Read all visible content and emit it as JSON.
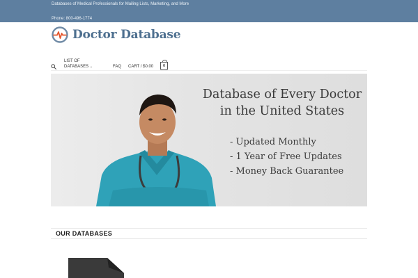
{
  "topbar": {
    "tagline": "Databases of Medical Professionals for Mailing Lists, Marketing, and More",
    "phone": "Phone: 800-496-1774",
    "color": "#5e7fa0"
  },
  "logo": {
    "text": "Doctor Database",
    "color": "#4d6f8f",
    "accent": "#e4572e"
  },
  "nav": {
    "search_icon": "search-icon",
    "list_line1": "List of",
    "list_line2": "Databases",
    "list_chevron": "⌄",
    "faq": "FAQ",
    "cart": "Cart / $0.00",
    "cart_count": "0"
  },
  "hero": {
    "title_line1": "Database of Every Doctor",
    "title_line2": "in the United States",
    "bullets": [
      "- Updated Monthly",
      "- 1 Year of Free Updates",
      "- Money Back Guarantee"
    ]
  },
  "section": {
    "title": "OUR DATABASES"
  }
}
